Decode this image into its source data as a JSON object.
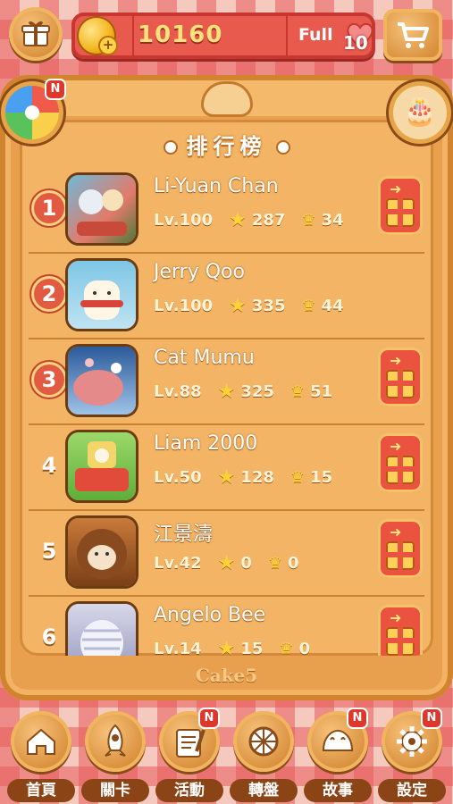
{
  "header": {
    "coins": "10160",
    "life_status": "Full",
    "lives": "10"
  },
  "leaderboard": {
    "title": "排行榜",
    "rows": [
      {
        "rank": "1",
        "name": "Li-Yuan Chan",
        "level": "Lv.100",
        "stars": "287",
        "crowns": "34",
        "has_gift": true
      },
      {
        "rank": "2",
        "name": "Jerry Qoo",
        "level": "Lv.100",
        "stars": "335",
        "crowns": "44",
        "has_gift": false
      },
      {
        "rank": "3",
        "name": "Cat Mumu",
        "level": "Lv.88",
        "stars": "325",
        "crowns": "51",
        "has_gift": true
      },
      {
        "rank": "4",
        "name": "Liam 2000",
        "level": "Lv.50",
        "stars": "128",
        "crowns": "15",
        "has_gift": true
      },
      {
        "rank": "5",
        "name": "江景濤",
        "level": "Lv.42",
        "stars": "0",
        "crowns": "0",
        "has_gift": true
      },
      {
        "rank": "6",
        "name": "Angelo Bee",
        "level": "Lv.14",
        "stars": "15",
        "crowns": "0",
        "has_gift": true
      }
    ]
  },
  "badges": {
    "new": "N"
  },
  "brand": "Cake5",
  "nav": {
    "items": [
      {
        "label": "首頁",
        "icon": "home-icon",
        "new": false
      },
      {
        "label": "關卡",
        "icon": "rocket-icon",
        "new": false
      },
      {
        "label": "活動",
        "icon": "notepad-icon",
        "new": true
      },
      {
        "label": "轉盤",
        "icon": "wheel-icon",
        "new": false
      },
      {
        "label": "故事",
        "icon": "bun-icon",
        "new": true
      },
      {
        "label": "設定",
        "icon": "gear-icon",
        "new": true
      }
    ]
  },
  "colors": {
    "accent": "#e85a4e",
    "wood": "#e9a04e",
    "dark_brown": "#8a4416"
  }
}
